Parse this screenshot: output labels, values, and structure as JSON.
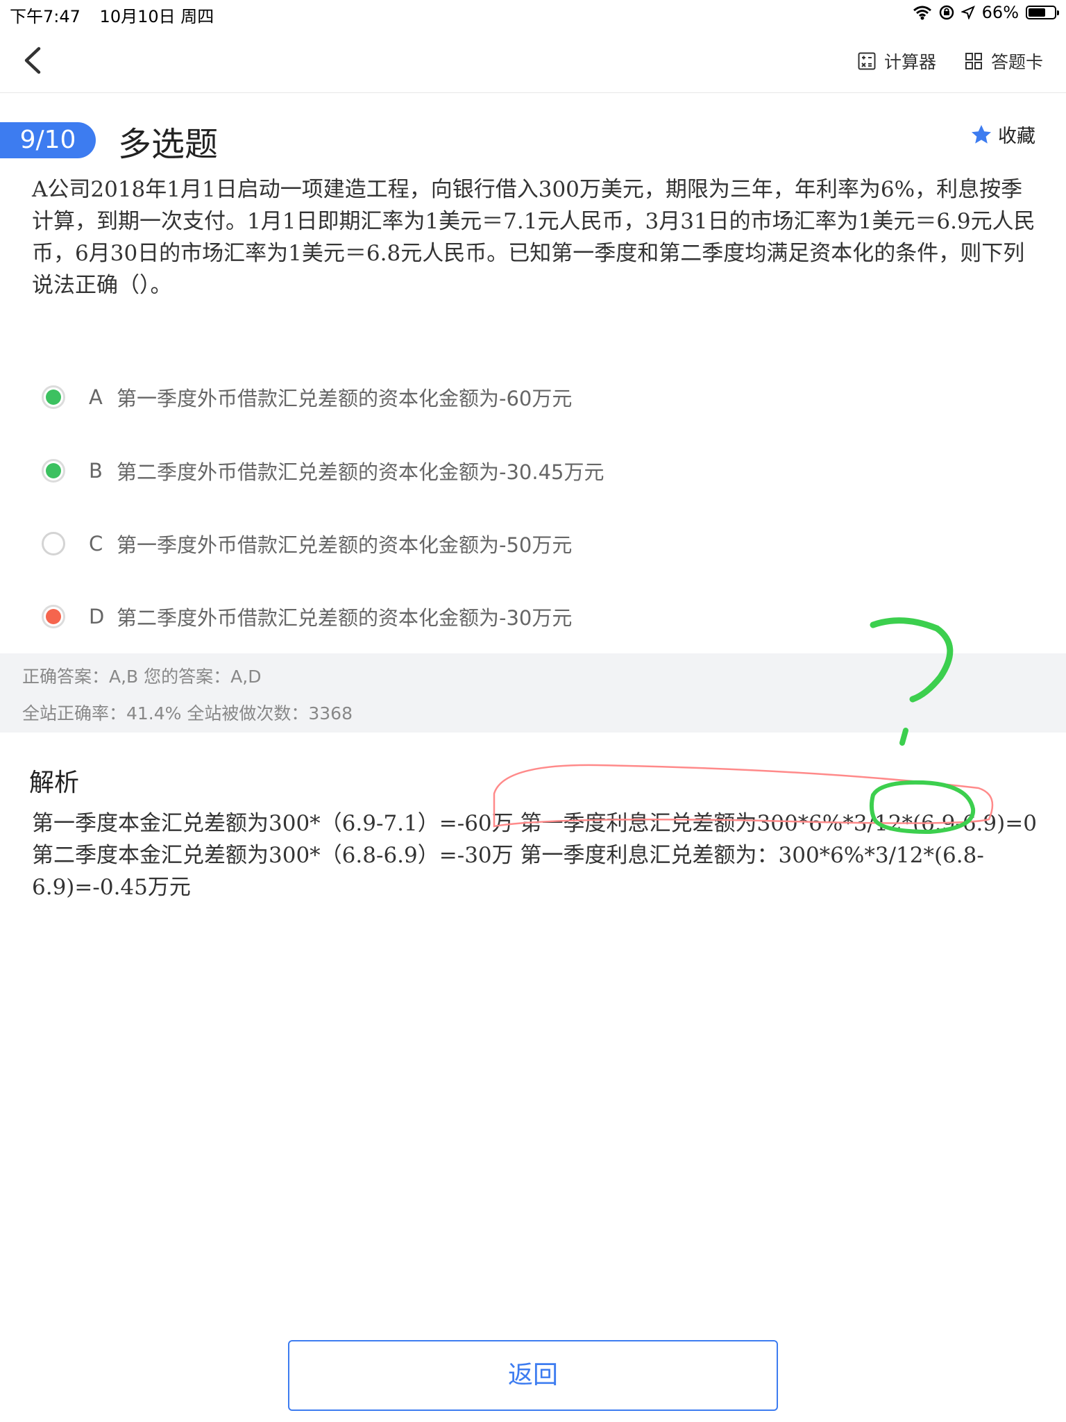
{
  "status_bar": {
    "time": "下午7:47",
    "date": "10月10日 周四",
    "battery": "66%",
    "battery_level": 0.66
  },
  "nav": {
    "calculator_label": "计算器",
    "answer_card_label": "答题卡"
  },
  "header": {
    "progress": "9/10",
    "question_type": "多选题",
    "favorite_label": "收藏",
    "accent_color": "#3d7cf0"
  },
  "question": {
    "text": "A公司2018年1月1日启动一项建造工程，向银行借入300万美元，期限为三年，年利率为6%，利息按季计算，到期一次支付。1月1日即期汇率为1美元＝7.1元人民币，3月31日的市场汇率为1美元＝6.9元人民币，6月30日的市场汇率为1美元＝6.8元人民币。已知第一季度和第二季度均满足资本化的条件，则下列说法正确（）。"
  },
  "options": [
    {
      "letter": "A",
      "text": "第一季度外币借款汇兑差额的资本化金额为-60万元",
      "state": "correct",
      "color": "#3cc160"
    },
    {
      "letter": "B",
      "text": "第二季度外币借款汇兑差额的资本化金额为-30.45万元",
      "state": "correct",
      "color": "#3cc160"
    },
    {
      "letter": "C",
      "text": "第一季度外币借款汇兑差额的资本化金额为-50万元",
      "state": "unselected",
      "color": "#ffffff"
    },
    {
      "letter": "D",
      "text": "第二季度外币借款汇兑差额的资本化金额为-30万元",
      "state": "wrong",
      "color": "#f5654e"
    }
  ],
  "result": {
    "answers": "正确答案：A,B 您的答案：A,D",
    "stats": "全站正确率：41.4% 全站被做次数：3368"
  },
  "analysis": {
    "title": "解析",
    "text": "第一季度本金汇兑差额为300*（6.9-7.1）=-60万 第一季度利息汇兑差额为300*6%*3/12*(6.9-6.9)=0 第二季度本金汇兑差额为300*（6.8-6.9）=-30万 第一季度利息汇兑差额为：300*6%*3/12*(6.8-6.9)=-0.45万元"
  },
  "bottom": {
    "back_label": "返回"
  }
}
